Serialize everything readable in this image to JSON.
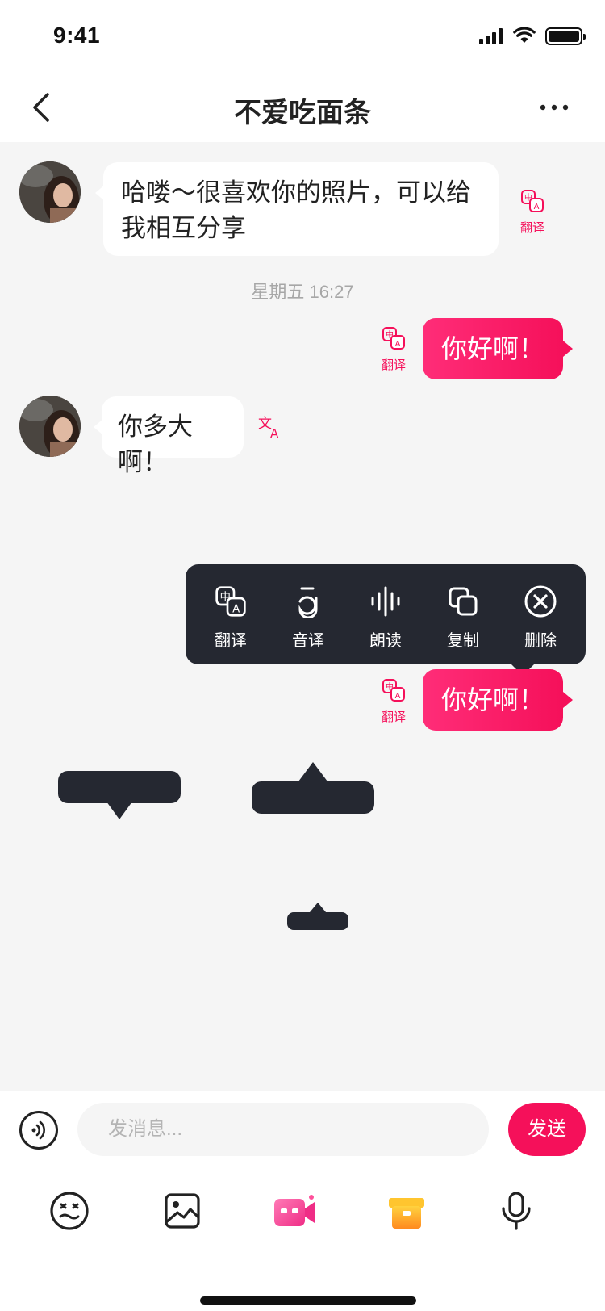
{
  "status_bar": {
    "time": "9:41"
  },
  "header": {
    "title": "不爱吃面条"
  },
  "chat": {
    "messages": [
      {
        "text": "哈喽～很喜欢你的照片，可以给我相互分享",
        "translate_label": "翻译"
      },
      {
        "text": "你好啊！",
        "translate_label": "翻译"
      },
      {
        "text": "你多大啊！"
      },
      {
        "text": "你好啊！",
        "translate_label": "翻译"
      }
    ],
    "timestamp": "星期五 16:27"
  },
  "context_menu": {
    "items": [
      {
        "label": "翻译",
        "icon": "translate-icon"
      },
      {
        "label": "音译",
        "icon": "transliterate-icon"
      },
      {
        "label": "朗读",
        "icon": "read-aloud-icon"
      },
      {
        "label": "复制",
        "icon": "copy-icon"
      },
      {
        "label": "删除",
        "icon": "delete-icon"
      }
    ]
  },
  "input": {
    "placeholder": "发消息...",
    "send_label": "发送"
  },
  "toolbar": {
    "icons": [
      "emoji-icon",
      "image-icon",
      "video-call-icon",
      "gift-icon",
      "microphone-icon"
    ]
  },
  "colors": {
    "accent": "#f5105a",
    "dark_popup": "#252831",
    "chat_bg": "#f5f5f5"
  }
}
